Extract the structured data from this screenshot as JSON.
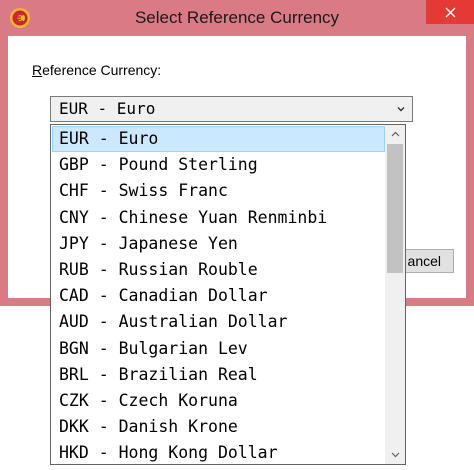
{
  "window": {
    "title": "Select Reference Currency",
    "close_icon": "close-icon",
    "app_icon": "currency-app-icon",
    "accent_color": "#d97a85"
  },
  "form": {
    "reference_label": "Reference Currency:",
    "selected_value": "EUR - Euro"
  },
  "buttons": {
    "cancel_label": "ancel"
  },
  "dropdown": {
    "selected_index": 0,
    "items": [
      "EUR - Euro",
      "GBP - Pound Sterling",
      "CHF - Swiss Franc",
      "CNY - Chinese Yuan Renminbi",
      "JPY - Japanese Yen",
      "RUB - Russian Rouble",
      "CAD - Canadian Dollar",
      "AUD - Australian Dollar",
      "BGN - Bulgarian Lev",
      "BRL - Brazilian Real",
      "CZK - Czech Koruna",
      "DKK - Danish Krone",
      "HKD - Hong Kong Dollar"
    ],
    "scroll": {
      "thumb_fraction": 0.43,
      "position_fraction": 0
    }
  }
}
